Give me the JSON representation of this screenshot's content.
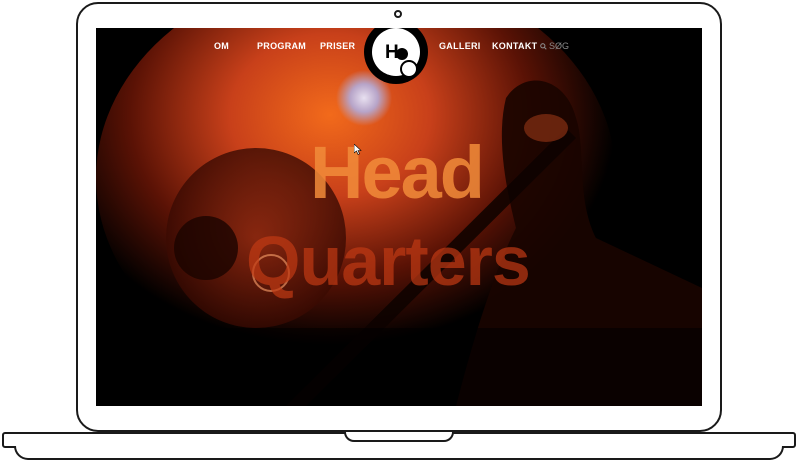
{
  "nav": {
    "items": [
      "OM",
      "PROGRAM",
      "PRISER",
      "GALLERI",
      "KONTAKT"
    ],
    "search_label": "SØG"
  },
  "logo": {
    "letter": "H"
  },
  "hero": {
    "line1": "Head",
    "line2": "Quarters"
  },
  "colors": {
    "screen_bg": "#000000",
    "glow_orange": "#f26a1b",
    "glow_red": "#b8320f",
    "frame": "#1a1a1a"
  }
}
